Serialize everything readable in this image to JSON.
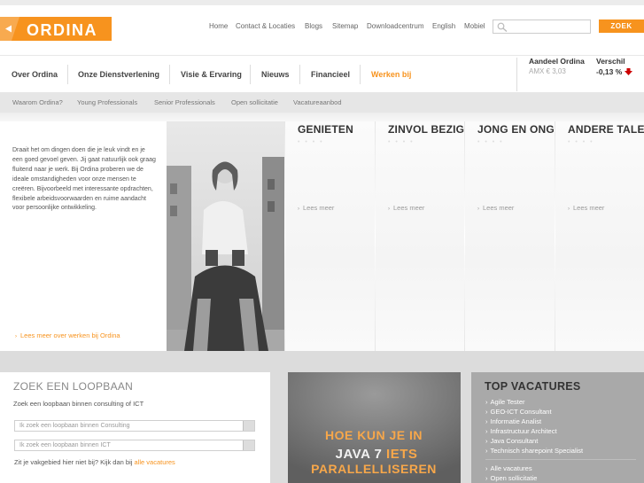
{
  "logo": {
    "text": "ORDINA",
    "icon": "ordina-logo"
  },
  "topnav": [
    "Home",
    "Contact & Locaties",
    "Blogs",
    "Sitemap",
    "Downloadcentrum",
    "English",
    "Mobiel"
  ],
  "search": {
    "placeholder": "",
    "button": "ZOEK"
  },
  "mainnav": [
    "Over Ordina",
    "Onze Dienstverlening",
    "Visie & Ervaring",
    "Nieuws",
    "Financieel",
    "Werken bij"
  ],
  "active_nav": "Werken bij",
  "stock": {
    "label": "Aandeel Ordina",
    "sub": "AMX € 3,03",
    "change_label": "Verschil",
    "change_value": "-0,13 %",
    "direction": "down",
    "down_color": "#cc0000"
  },
  "subnav": [
    "Waarom Ordina?",
    "Young Professionals",
    "Senior Professionals",
    "Open sollicitatie",
    "Vacatureaanbod"
  ],
  "intro": {
    "text": "Draait het om dingen doen die je leuk vindt en je een goed gevoel geven. Jij gaat natuurlijk ook graag fluitend naar je werk. Bij Ordina proberen we de ideale omstandigheden voor onze mensen te creëren. Bijvoorbeeld met interessante opdrachten, flexibele arbeidsvoorwaarden en ruime aandacht voor persoonlijke ontwikkeling.",
    "link": "Lees meer over werken bij Ordina"
  },
  "tiles": [
    {
      "title": "GENIETEN",
      "link": "Lees meer"
    },
    {
      "title": "ZINVOL BEZIG",
      "link": "Lees meer"
    },
    {
      "title": "JONG EN ONG",
      "link": "Lees meer"
    },
    {
      "title": "ANDERE TALE",
      "link": "Lees meer"
    }
  ],
  "career_search": {
    "title": "ZOEK EEN LOOPBAAN",
    "subtitle": "Zoek een loopbaan binnen consulting of ICT",
    "select1": "Ik zoek een loopbaan binnen Consulting",
    "select2": "Ik zoek een loopbaan binnen ICT",
    "footer_text": "Zit je vakgebied hier niet bij? Kijk dan bij",
    "footer_link": "alle vacatures"
  },
  "banner": {
    "line1": "HOE KUN JE IN",
    "line2a": "JAVA",
    "line2b": "7",
    "line2c": "IETS",
    "line3": "PARALLELLISEREN"
  },
  "vacatures": {
    "title": "TOP VACATURES",
    "items": [
      "Agile Tester",
      "GEO-ICT Consultant",
      "Informatie Analist",
      "Infrastructuur Architect",
      "Java Consultant",
      "Technisch sharepoint Specialist"
    ],
    "more": [
      "Alle vacatures",
      "Open sollicitatie"
    ]
  },
  "colors": {
    "accent": "#f7931e",
    "text": "#444444",
    "muted": "#888888"
  }
}
